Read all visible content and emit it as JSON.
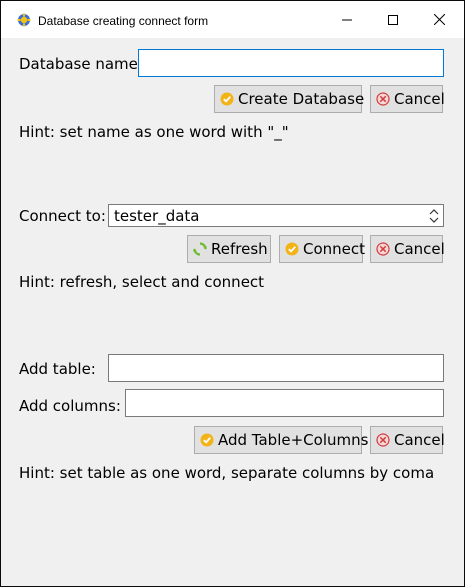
{
  "window": {
    "title": "Database creating connect form"
  },
  "create_section": {
    "label": "Database name:",
    "input_value": "",
    "create_button": "Create Database",
    "cancel_button": "Cancel",
    "hint": "Hint: set name as one word with \"_\""
  },
  "connect_section": {
    "label": "Connect to:",
    "selected_db": "tester_data",
    "refresh_button": "Refresh",
    "connect_button": "Connect",
    "cancel_button": "Cancel",
    "hint": "Hint: refresh, select and connect"
  },
  "table_section": {
    "table_label": "Add table:",
    "table_value": "",
    "columns_label": "Add columns:",
    "columns_value": "",
    "add_button": "Add Table+Columns",
    "cancel_button": "Cancel",
    "hint": "Hint: set table as one word, separate columns by coma"
  },
  "colors": {
    "accent": "#0078d7",
    "background": "#f0f0f0",
    "button": "#e1e1e1"
  },
  "icons": [
    "app-icon",
    "minimize-icon",
    "maximize-icon",
    "close-icon",
    "check-icon",
    "cancel-icon",
    "refresh-icon",
    "spin-arrows-icon"
  ]
}
